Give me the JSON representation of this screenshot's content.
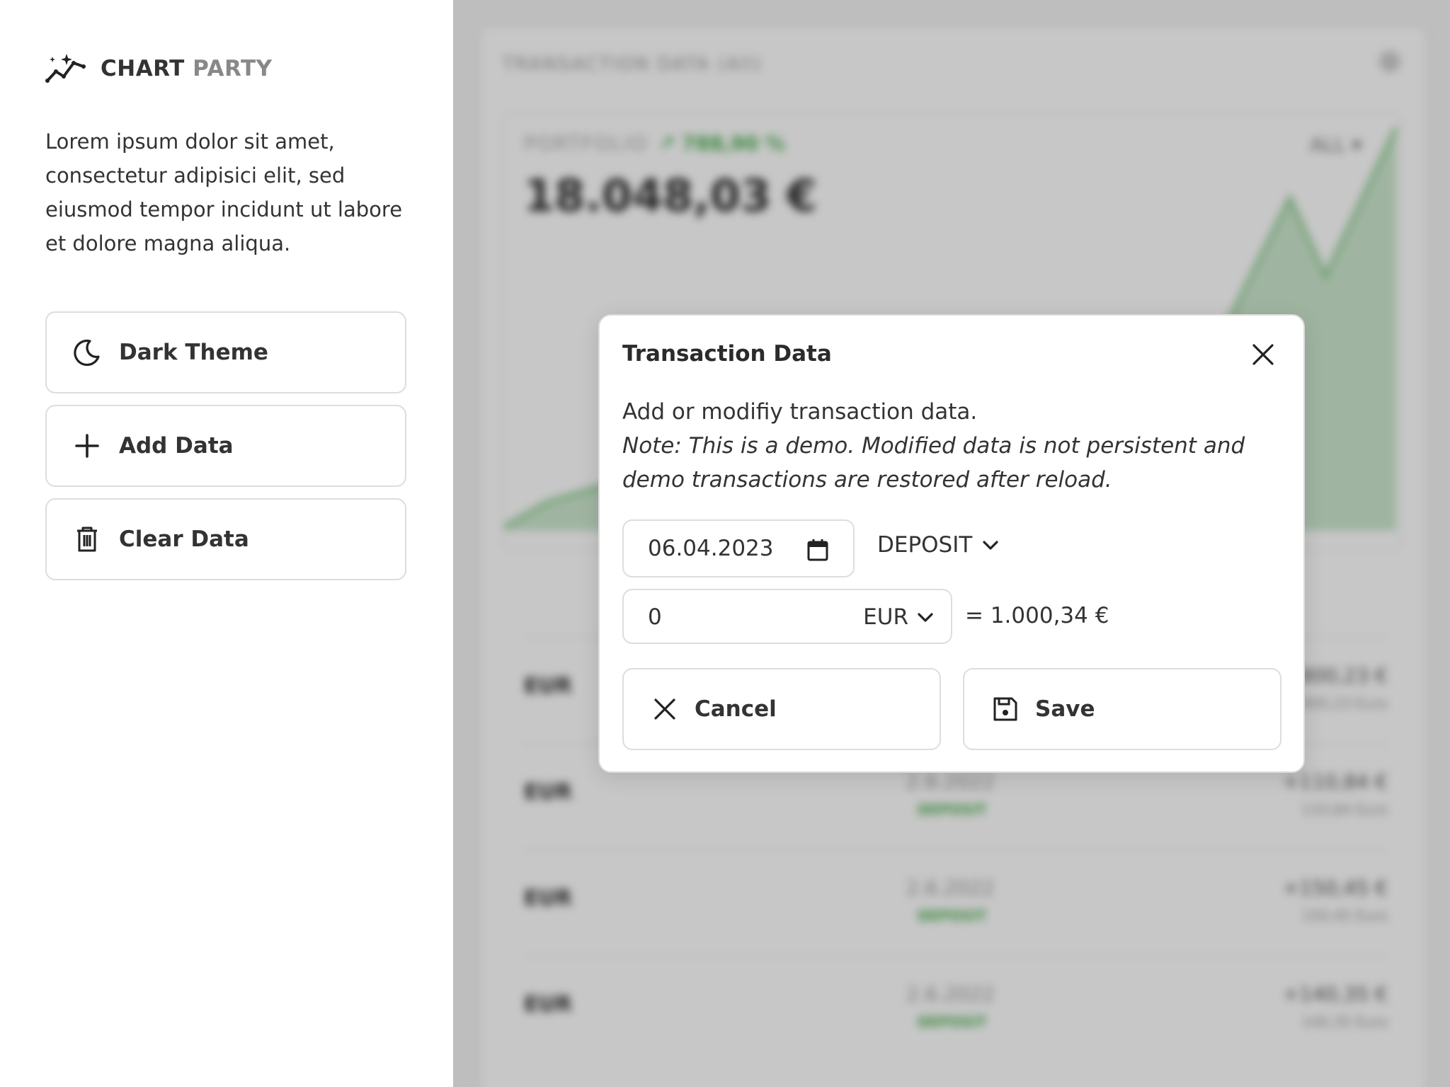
{
  "app": {
    "brand_part1": "CHART",
    "brand_part2": "PARTY",
    "intro": "Lorem ipsum dolor sit amet, consectetur adipisici elit, sed eiusmod tempor incidunt ut labore et dolore magna aliqua."
  },
  "sidebar": {
    "buttons": [
      {
        "label": "Dark Theme",
        "icon": "moon-icon"
      },
      {
        "label": "Add Data",
        "icon": "plus-icon"
      },
      {
        "label": "Clear Data",
        "icon": "trash-icon"
      }
    ]
  },
  "background": {
    "title": "TRANSACTION DATA (All)",
    "portfolio_label": "PORTFOLIO",
    "portfolio_change": "↗ 788,90 %",
    "portfolio_value": "18.048,03 €",
    "range": "ALL ▾",
    "rows": [
      {
        "asset": "EUR",
        "date": "",
        "type": "",
        "amount": "800,23 €",
        "sub": "800,23 Euro"
      },
      {
        "asset": "EUR",
        "date": "2.6.2022",
        "type": "DEPOSIT",
        "amount": "+110,84 €",
        "sub": "110,84 Euro"
      },
      {
        "asset": "EUR",
        "date": "2.6.2022",
        "type": "DEPOSIT",
        "amount": "+150,45 €",
        "sub": "150,45 Euro"
      },
      {
        "asset": "EUR",
        "date": "2.6.2022",
        "type": "DEPOSIT",
        "amount": "+140,35 €",
        "sub": "140,35 Euro"
      }
    ]
  },
  "modal": {
    "title": "Transaction Data",
    "description": "Add or modifiy transaction data.",
    "note": "Note: This is a demo. Modified data is not persistent and demo transactions are restored after reload.",
    "date_value": "06.04.2023",
    "type_value": "DEPOSIT",
    "amount_value": "0",
    "currency_value": "EUR",
    "converted": "= 1.000,34 €",
    "cancel_label": "Cancel",
    "save_label": "Save"
  },
  "colors": {
    "accent_green": "#4caf50",
    "border": "#dddddd",
    "text": "#333333"
  }
}
